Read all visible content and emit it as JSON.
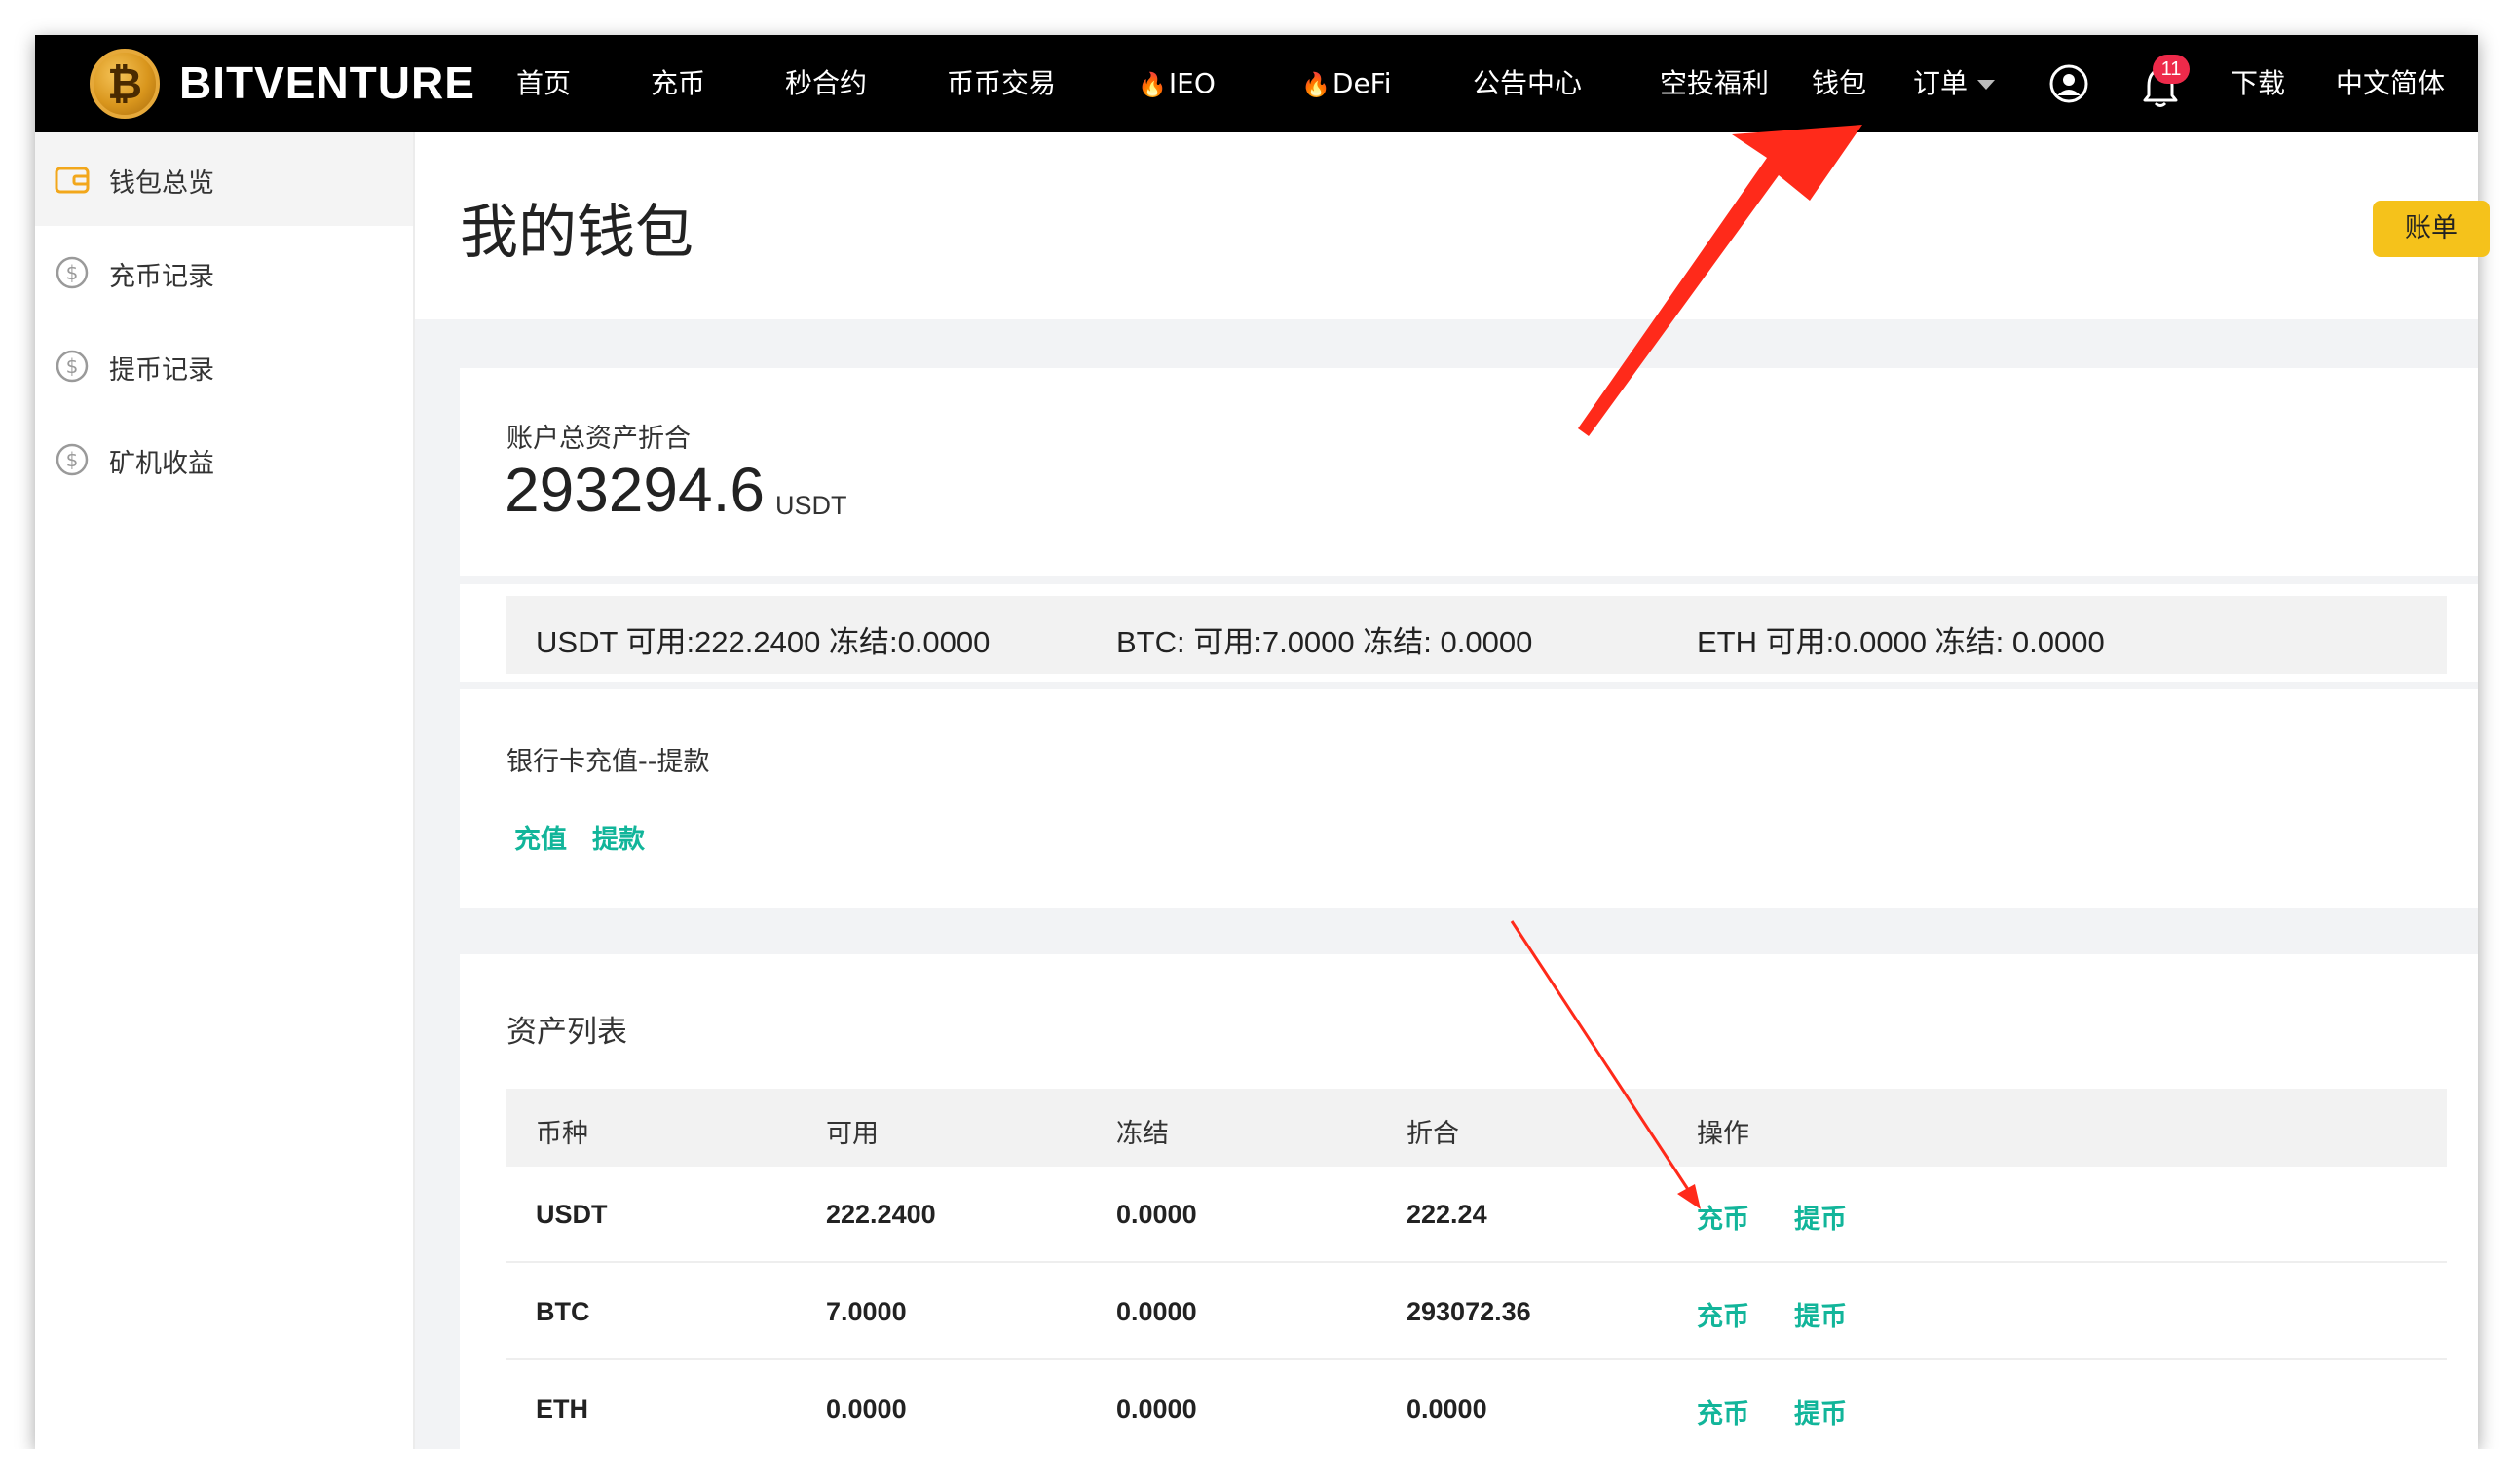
{
  "nav": {
    "brand": "BITVENTURE",
    "items": [
      "首页",
      "充币",
      "秒合约",
      "币币交易",
      "IEO",
      "DeFi",
      "公告中心",
      "空投福利",
      "钱包",
      "订单"
    ],
    "notification_count": "11",
    "download": "下载",
    "language": "中文简体"
  },
  "sidebar": {
    "items": [
      {
        "label": "钱包总览",
        "icon": "wallet-icon"
      },
      {
        "label": "充币记录",
        "icon": "dollar-circle-icon"
      },
      {
        "label": "提币记录",
        "icon": "dollar-circle-icon"
      },
      {
        "label": "矿机收益",
        "icon": "dollar-circle-icon"
      }
    ]
  },
  "page": {
    "title": "我的钱包",
    "bill_button": "账单"
  },
  "summary": {
    "label": "账户总资产折合",
    "value": "293294.6",
    "unit": "USDT"
  },
  "balances": [
    "USDT 可用:222.2400 冻结:0.0000",
    "BTC: 可用:7.0000 冻结: 0.0000",
    "ETH 可用:0.0000 冻结: 0.0000"
  ],
  "bank": {
    "title": "银行卡充值--提款",
    "deposit": "充值",
    "withdraw": "提款"
  },
  "assets": {
    "title": "资产列表",
    "columns": [
      "币种",
      "可用",
      "冻结",
      "折合",
      "操作"
    ],
    "rows": [
      {
        "coin": "USDT",
        "available": "222.2400",
        "frozen": "0.0000",
        "equivalent": "222.24",
        "deposit": "充币",
        "withdraw": "提币"
      },
      {
        "coin": "BTC",
        "available": "7.0000",
        "frozen": "0.0000",
        "equivalent": "293072.36",
        "deposit": "充币",
        "withdraw": "提币"
      },
      {
        "coin": "ETH",
        "available": "0.0000",
        "frozen": "0.0000",
        "equivalent": "0.0000",
        "deposit": "充币",
        "withdraw": "提币"
      }
    ]
  },
  "colors": {
    "accent_green": "#12b59a",
    "bill_yellow": "#f5c21b",
    "annotation_red": "#ff2a1a",
    "badge_red": "#ee2a4a"
  }
}
